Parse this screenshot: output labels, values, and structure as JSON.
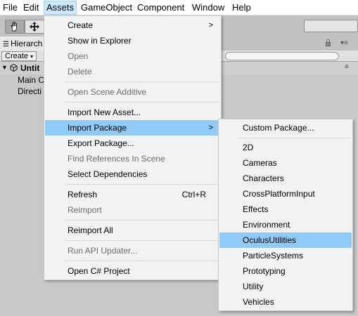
{
  "menubar": {
    "items": [
      "File",
      "Edit",
      "Assets",
      "GameObject",
      "Component",
      "Window",
      "Help"
    ]
  },
  "hierarchy": {
    "tab_label": "Hierarch",
    "create_label": "Create",
    "scene_name": "Untit",
    "items": [
      "Main C",
      "Directi"
    ]
  },
  "assets_menu": {
    "items": [
      {
        "label": "Create",
        "submenu": true
      },
      {
        "label": "Show in Explorer"
      },
      {
        "label": "Open",
        "disabled": true
      },
      {
        "label": "Delete",
        "disabled": true
      },
      {
        "label": "Open Scene Additive",
        "disabled": true
      },
      {
        "label": "Import New Asset..."
      },
      {
        "label": "Import Package",
        "submenu": true,
        "highlighted": true
      },
      {
        "label": "Export Package..."
      },
      {
        "label": "Find References In Scene",
        "disabled": true
      },
      {
        "label": "Select Dependencies"
      },
      {
        "label": "Refresh",
        "shortcut": "Ctrl+R"
      },
      {
        "label": "Reimport",
        "disabled": true
      },
      {
        "label": "Reimport All"
      },
      {
        "label": "Run API Updater...",
        "disabled": true
      },
      {
        "label": "Open C# Project"
      }
    ]
  },
  "import_package_menu": {
    "items": [
      {
        "label": "Custom Package..."
      },
      {
        "label": "2D"
      },
      {
        "label": "Cameras"
      },
      {
        "label": "Characters"
      },
      {
        "label": "CrossPlatformInput"
      },
      {
        "label": "Effects"
      },
      {
        "label": "Environment"
      },
      {
        "label": "OculusUtilities",
        "highlighted": true
      },
      {
        "label": "ParticleSystems"
      },
      {
        "label": "Prototyping"
      },
      {
        "label": "Utility"
      },
      {
        "label": "Vehicles"
      }
    ]
  },
  "colors": {
    "highlight": "#91c9f7",
    "menu_bg": "#f2f2f2",
    "active_menu": "#cce8ff"
  }
}
